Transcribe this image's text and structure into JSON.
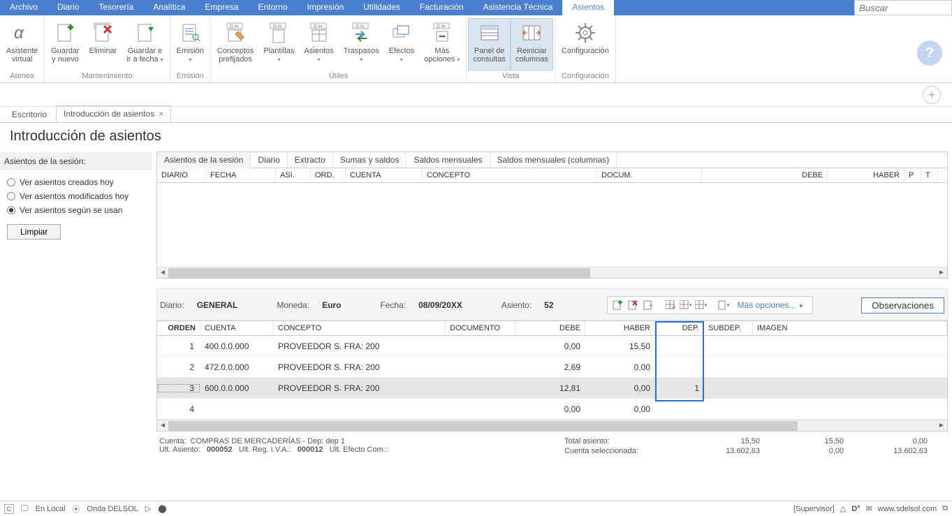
{
  "menu": {
    "items": [
      "Archivo",
      "Diario",
      "Tesorería",
      "Analítica",
      "Empresa",
      "Entorno",
      "Impresión",
      "Utilidades",
      "Facturación",
      "Asistencia Técnica",
      "Asientos"
    ],
    "active_index": 10,
    "search_placeholder": "Buscar"
  },
  "ribbon": {
    "groups": [
      {
        "label": "Atenea",
        "buttons": [
          {
            "line1": "Asistente",
            "line2": "virtual",
            "icon": "alpha"
          }
        ]
      },
      {
        "label": "Mantenimiento",
        "buttons": [
          {
            "line1": "Guardar",
            "line2": "y nuevo",
            "icon": "doc-plus"
          },
          {
            "line1": "Eliminar",
            "line2": "",
            "icon": "doc-x"
          },
          {
            "line1": "Guardar e",
            "line2": "ir a fecha",
            "icon": "doc-arrow",
            "dropdown": true
          }
        ]
      },
      {
        "label": "Emisión",
        "buttons": [
          {
            "line1": "Emisión",
            "line2": "",
            "icon": "doc-lines",
            "dropdown": true
          }
        ]
      },
      {
        "label": "Útiles",
        "buttons": [
          {
            "line1": "Conceptos",
            "line2": "prefijados",
            "icon": "dh-pencil"
          },
          {
            "line1": "Plantillas",
            "line2": "",
            "icon": "dh-doc",
            "dropdown": true
          },
          {
            "line1": "Asientos",
            "line2": "",
            "icon": "dh-ledger",
            "dropdown": true
          },
          {
            "line1": "Traspasos",
            "line2": "",
            "icon": "dh-swap",
            "dropdown": true
          },
          {
            "line1": "Efectos",
            "line2": "",
            "icon": "cards",
            "dropdown": true
          },
          {
            "line1": "Más",
            "line2": "opciones",
            "icon": "dh-dots",
            "dropdown": true
          }
        ]
      },
      {
        "label": "Vista",
        "buttons": [
          {
            "line1": "Panel de",
            "line2": "consultas",
            "icon": "panel",
            "highlighted": true
          },
          {
            "line1": "Reiniciar",
            "line2": "columnas",
            "icon": "columns",
            "highlighted": true
          }
        ]
      },
      {
        "label": "Configuración",
        "buttons": [
          {
            "line1": "Configuración",
            "line2": "",
            "icon": "gear"
          }
        ]
      }
    ]
  },
  "doctabs": {
    "tabs": [
      {
        "label": "Escritorio",
        "closable": false,
        "active": false
      },
      {
        "label": "Introducción de asientos",
        "closable": true,
        "active": true
      }
    ]
  },
  "page_title": "Introducción de asientos",
  "sidebar": {
    "header": "Asientos de la sesión:",
    "radios": [
      {
        "label": "Ver asientos creados hoy",
        "checked": false
      },
      {
        "label": "Ver asientos modificados hoy",
        "checked": false
      },
      {
        "label": "Ver asientos según se usan",
        "checked": true
      }
    ],
    "clear_button": "Limpiar"
  },
  "inner_tabs": [
    "Asientos de la sesión",
    "Diario",
    "Extracto",
    "Sumas y saldos",
    "Saldos mensuales",
    "Saldos mensuales (columnas)"
  ],
  "inner_tabs_active": 0,
  "upper_grid": {
    "columns": [
      "DIARIO",
      "FECHA",
      "ASI.",
      "ORD.",
      "CUENTA",
      "CONCEPTO",
      "DOCUM.",
      "DEBE",
      "HABER",
      "P",
      "T"
    ]
  },
  "entry_info": {
    "diario_label": "Diario:",
    "diario_value": "GENERAL",
    "moneda_label": "Moneda:",
    "moneda_value": "Euro",
    "fecha_label": "Fecha:",
    "fecha_value": "08/09/20XX",
    "asiento_label": "Asiento:",
    "asiento_value": "52",
    "more_options": "Más opciones...",
    "observaciones": "Observaciones"
  },
  "lower_grid": {
    "columns": [
      "ORDEN",
      "CUENTA",
      "CONCEPTO",
      "DOCUMENTO",
      "DEBE",
      "HABER",
      "DEP.",
      "SUBDEP.",
      "IMAGEN"
    ],
    "rows": [
      {
        "orden": "1",
        "cuenta": "400.0.0.000",
        "concepto": "PROVEEDOR S. FRA:  200",
        "documento": "",
        "debe": "0,00",
        "haber": "15,50",
        "dep": "",
        "subdep": "",
        "imagen": ""
      },
      {
        "orden": "2",
        "cuenta": "472.0.0.000",
        "concepto": "PROVEEDOR S. FRA:  200",
        "documento": "",
        "debe": "2,69",
        "haber": "0,00",
        "dep": "",
        "subdep": "",
        "imagen": ""
      },
      {
        "orden": "3",
        "cuenta": "600.0.0.000",
        "concepto": "PROVEEDOR S. FRA:  200",
        "documento": "",
        "debe": "12,81",
        "haber": "0,00",
        "dep": "1",
        "subdep": "",
        "imagen": "",
        "selected": true
      },
      {
        "orden": "4",
        "cuenta": "",
        "concepto": "",
        "documento": "",
        "debe": "0,00",
        "haber": "0,00",
        "dep": "",
        "subdep": "",
        "imagen": ""
      }
    ]
  },
  "footer": {
    "cuenta_label": "Cuenta:",
    "cuenta_value": "COMPRAS DE MERCADERÍAS - Dep: dep 1",
    "ult_asiento_label": "Ult. Asiento:",
    "ult_asiento_value": "000052",
    "ult_reg_label": "Ult. Reg. I.V.A.:",
    "ult_reg_value": "000012",
    "ult_efecto_label": "Ult. Efecto Com.:",
    "total_asiento_label": "Total asiento:",
    "cuenta_sel_label": "Cuenta seleccionada:",
    "totals": {
      "r1c1": "15,50",
      "r1c2": "15,50",
      "r1c3": "0,00",
      "r2c1": "13.602,63",
      "r2c2": "0,00",
      "r2c3": "13.602,63"
    }
  },
  "statusbar": {
    "c": "C",
    "en_local": "En Local",
    "onda": "Onda DELSOL",
    "supervisor": "[Supervisor]",
    "site": "www.sdelsol.com"
  }
}
